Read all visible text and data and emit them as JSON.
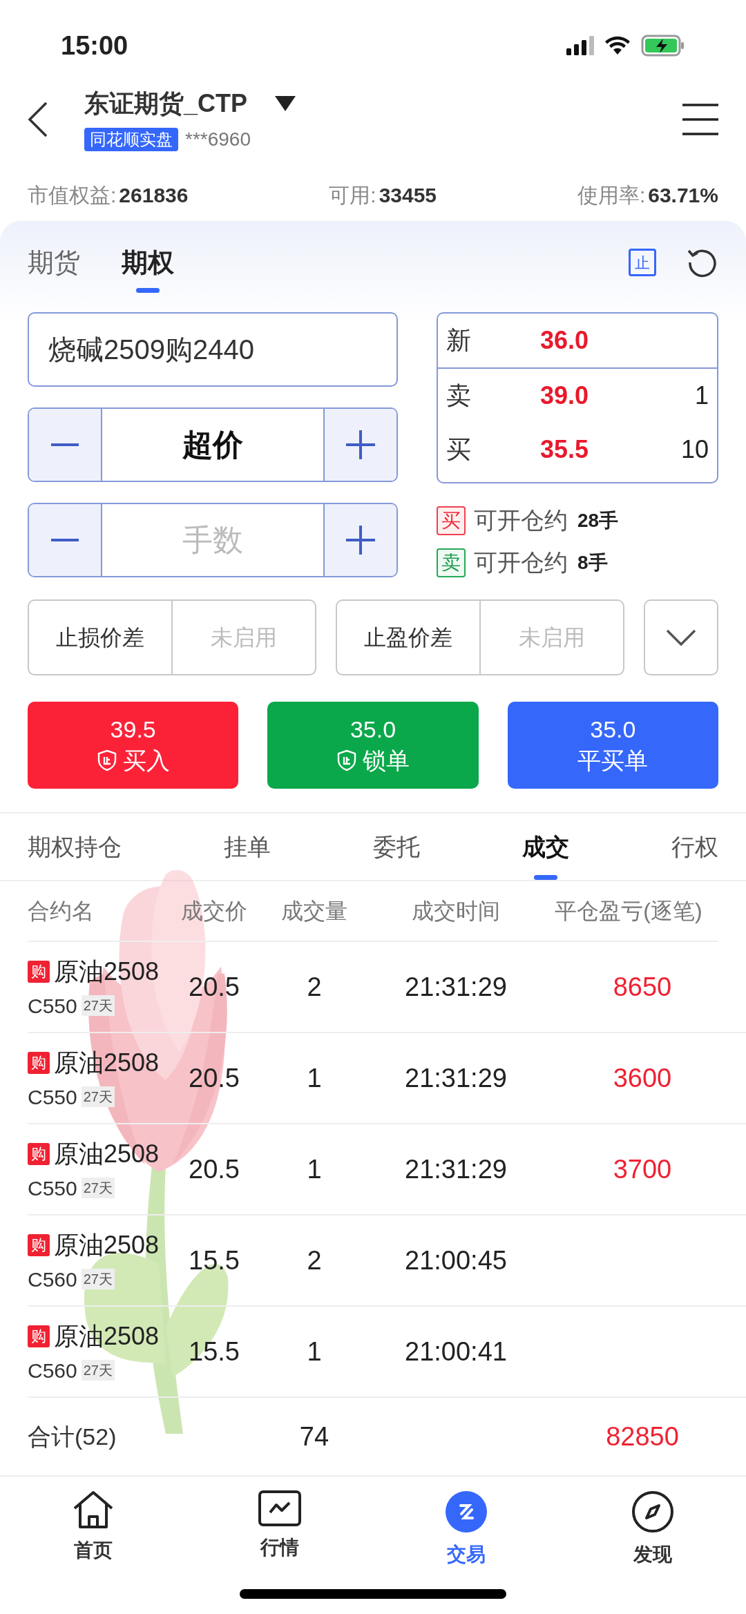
{
  "status_bar": {
    "time": "15:00"
  },
  "header": {
    "title": "东证期货_CTP",
    "badge": "同花顺实盘",
    "account": "***6960"
  },
  "stats": [
    {
      "label": "市值权益:",
      "value": "261836"
    },
    {
      "label": "可用:",
      "value": "33455"
    },
    {
      "label": "使用率:",
      "value": "63.71%"
    }
  ],
  "tabs": [
    {
      "label": "期货",
      "selected": false
    },
    {
      "label": "期权",
      "selected": true
    }
  ],
  "stop_badge": "止",
  "order": {
    "contract": "烧碱2509购2440",
    "price_mode": "超价",
    "quantity_placeholder": "手数"
  },
  "quote": [
    {
      "label": "新",
      "price": "36.0"
    },
    {
      "label": "卖",
      "price": "39.0",
      "volume": "1"
    },
    {
      "label": "买",
      "price": "35.5",
      "volume": "10"
    }
  ],
  "available": [
    {
      "kind": "buy",
      "tag": "买",
      "text": "可开仓约",
      "count": "28手"
    },
    {
      "kind": "sell",
      "tag": "卖",
      "text": "可开仓约",
      "count": "8手"
    }
  ],
  "stops": [
    {
      "label": "止损价差",
      "placeholder": "未启用"
    },
    {
      "label": "止盈价差",
      "placeholder": "未启用"
    }
  ],
  "actions": [
    {
      "kind": "buy",
      "price": "39.5",
      "label": "买入",
      "shield": true
    },
    {
      "kind": "lock",
      "price": "35.0",
      "label": "锁单",
      "shield": true
    },
    {
      "kind": "close",
      "price": "35.0",
      "label": "平买单",
      "shield": false
    }
  ],
  "sub_tabs": [
    {
      "label": "期权持仓",
      "selected": false
    },
    {
      "label": "挂单",
      "selected": false
    },
    {
      "label": "委托",
      "selected": false
    },
    {
      "label": "成交",
      "selected": true
    },
    {
      "label": "行权",
      "selected": false
    }
  ],
  "table": {
    "columns": [
      "合约名",
      "成交价",
      "成交量",
      "成交时间",
      "平仓盈亏(逐笔)"
    ],
    "rows": [
      {
        "tag": "购",
        "name": "原油2508",
        "code": "C550",
        "days": "27天",
        "price": "20.5",
        "volume": "2",
        "time": "21:31:29",
        "pnl": "8650"
      },
      {
        "tag": "购",
        "name": "原油2508",
        "code": "C550",
        "days": "27天",
        "price": "20.5",
        "volume": "1",
        "time": "21:31:29",
        "pnl": "3600"
      },
      {
        "tag": "购",
        "name": "原油2508",
        "code": "C550",
        "days": "27天",
        "price": "20.5",
        "volume": "1",
        "time": "21:31:29",
        "pnl": "3700"
      },
      {
        "tag": "购",
        "name": "原油2508",
        "code": "C560",
        "days": "27天",
        "price": "15.5",
        "volume": "2",
        "time": "21:00:45"
      },
      {
        "tag": "购",
        "name": "原油2508",
        "code": "C560",
        "days": "27天",
        "price": "15.5",
        "volume": "1",
        "time": "21:00:41"
      }
    ],
    "total": {
      "label": "合计(52)",
      "volume": "74",
      "pnl": "82850"
    }
  },
  "nav": [
    {
      "label": "首页",
      "selected": false
    },
    {
      "label": "行情",
      "selected": false
    },
    {
      "label": "交易",
      "selected": true
    },
    {
      "label": "发现",
      "selected": false
    }
  ]
}
